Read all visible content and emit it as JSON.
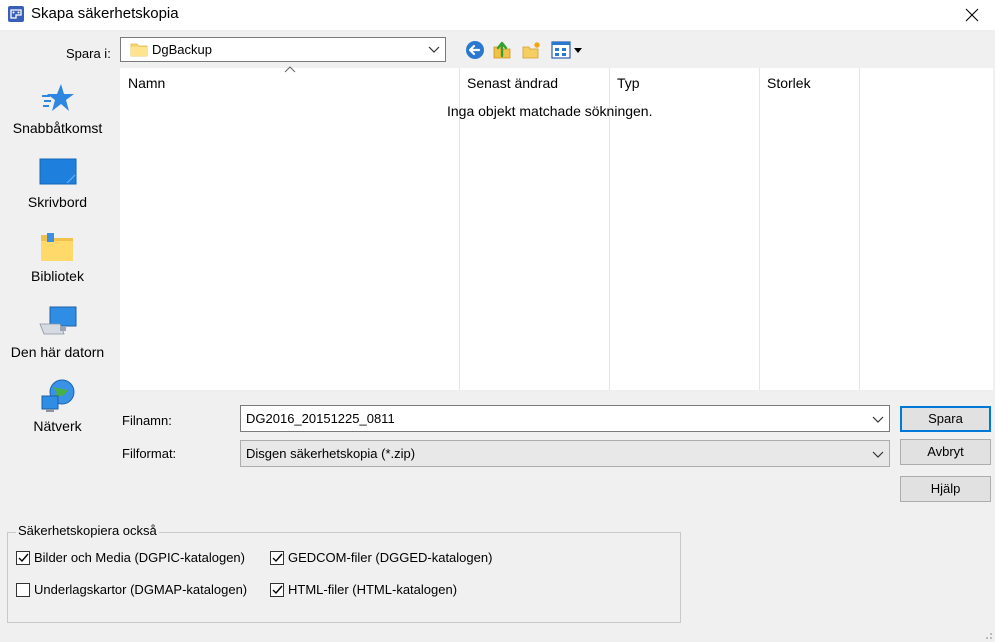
{
  "window": {
    "title": "Skapa säkerhetskopia"
  },
  "toolbar": {
    "save_in_label": "Spara i:",
    "folder": "DgBackup"
  },
  "places": [
    {
      "label": "Snabbåtkomst",
      "icon": "star-icon"
    },
    {
      "label": "Skrivbord",
      "icon": "desktop-icon"
    },
    {
      "label": "Bibliotek",
      "icon": "library-folder-icon"
    },
    {
      "label": "Den här datorn",
      "icon": "computer-icon"
    },
    {
      "label": "Nätverk",
      "icon": "network-globe-icon"
    }
  ],
  "filelist": {
    "columns": [
      "Namn",
      "Senast ändrad",
      "Typ",
      "Storlek"
    ],
    "empty_message": "Inga objekt matchade sökningen."
  },
  "form": {
    "filename_label": "Filnamn:",
    "filename_value": "DG2016_20151225_0811",
    "format_label": "Filformat:",
    "format_value": "Disgen säkerhetskopia (*.zip)"
  },
  "buttons": {
    "save": "Spara",
    "cancel": "Avbryt",
    "help": "Hjälp"
  },
  "also_backup": {
    "title": "Säkerhetskopiera också",
    "options": [
      {
        "label": "Bilder och Media (DGPIC-katalogen)",
        "checked": true
      },
      {
        "label": "GEDCOM-filer (DGGED-katalogen)",
        "checked": true
      },
      {
        "label": "Underlagskartor (DGMAP-katalogen)",
        "checked": false
      },
      {
        "label": "HTML-filer (HTML-katalogen)",
        "checked": true
      }
    ]
  },
  "colors": {
    "accent": "#0078d7",
    "dialog_bg": "#f0f0f0"
  }
}
